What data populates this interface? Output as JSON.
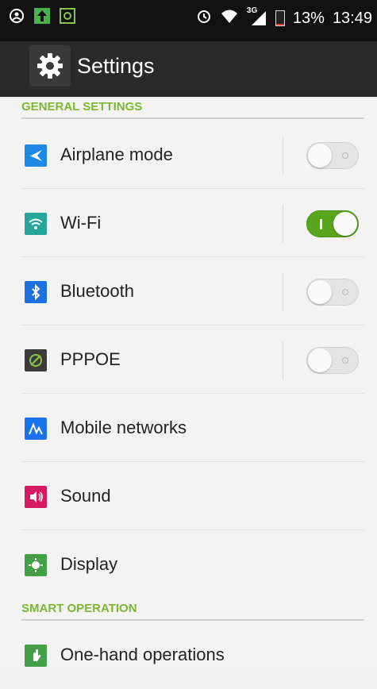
{
  "status_bar": {
    "battery_text": "13%",
    "time": "13:49",
    "network_label": "3G",
    "battery_level": 0.13,
    "left_icons": [
      "user-circle-icon",
      "upload-icon",
      "gallery-icon"
    ],
    "right_icons": [
      "alarm-icon",
      "wifi-icon",
      "signal-icon",
      "battery-icon"
    ]
  },
  "action_bar": {
    "title": "Settings",
    "icon": "gear-icon"
  },
  "sections": {
    "general": {
      "title": "GENERAL SETTINGS"
    },
    "smart": {
      "title": "SMART OPERATION"
    }
  },
  "items": {
    "airplane": {
      "label": "Airplane mode",
      "icon": "airplane-icon",
      "icon_color": "#1e88e5",
      "toggle_on": false
    },
    "wifi": {
      "label": "Wi-Fi",
      "icon": "wifi-icon",
      "icon_color": "#26a69a",
      "toggle_on": true
    },
    "bluetooth": {
      "label": "Bluetooth",
      "icon": "bluetooth-icon",
      "icon_color": "#1e6fe0",
      "toggle_on": false
    },
    "pppoe": {
      "label": "PPPOE",
      "icon": "pppoe-icon",
      "icon_color": "#3b3b3b",
      "toggle_on": false
    },
    "mobile": {
      "label": "Mobile networks",
      "icon": "mobile-networks-icon",
      "icon_color": "#1a73e8"
    },
    "sound": {
      "label": "Sound",
      "icon": "speaker-icon",
      "icon_color": "#d81b60"
    },
    "display": {
      "label": "Display",
      "icon": "display-icon",
      "icon_color": "#43a047"
    },
    "onehand": {
      "label": "One-hand operations",
      "icon": "hand-icon",
      "icon_color": "#43a047"
    }
  },
  "colors": {
    "accent": "#7cb82f",
    "toggle_on": "#5aa51e",
    "status_bar": "#111111",
    "action_bar": "#2a2a2a"
  }
}
